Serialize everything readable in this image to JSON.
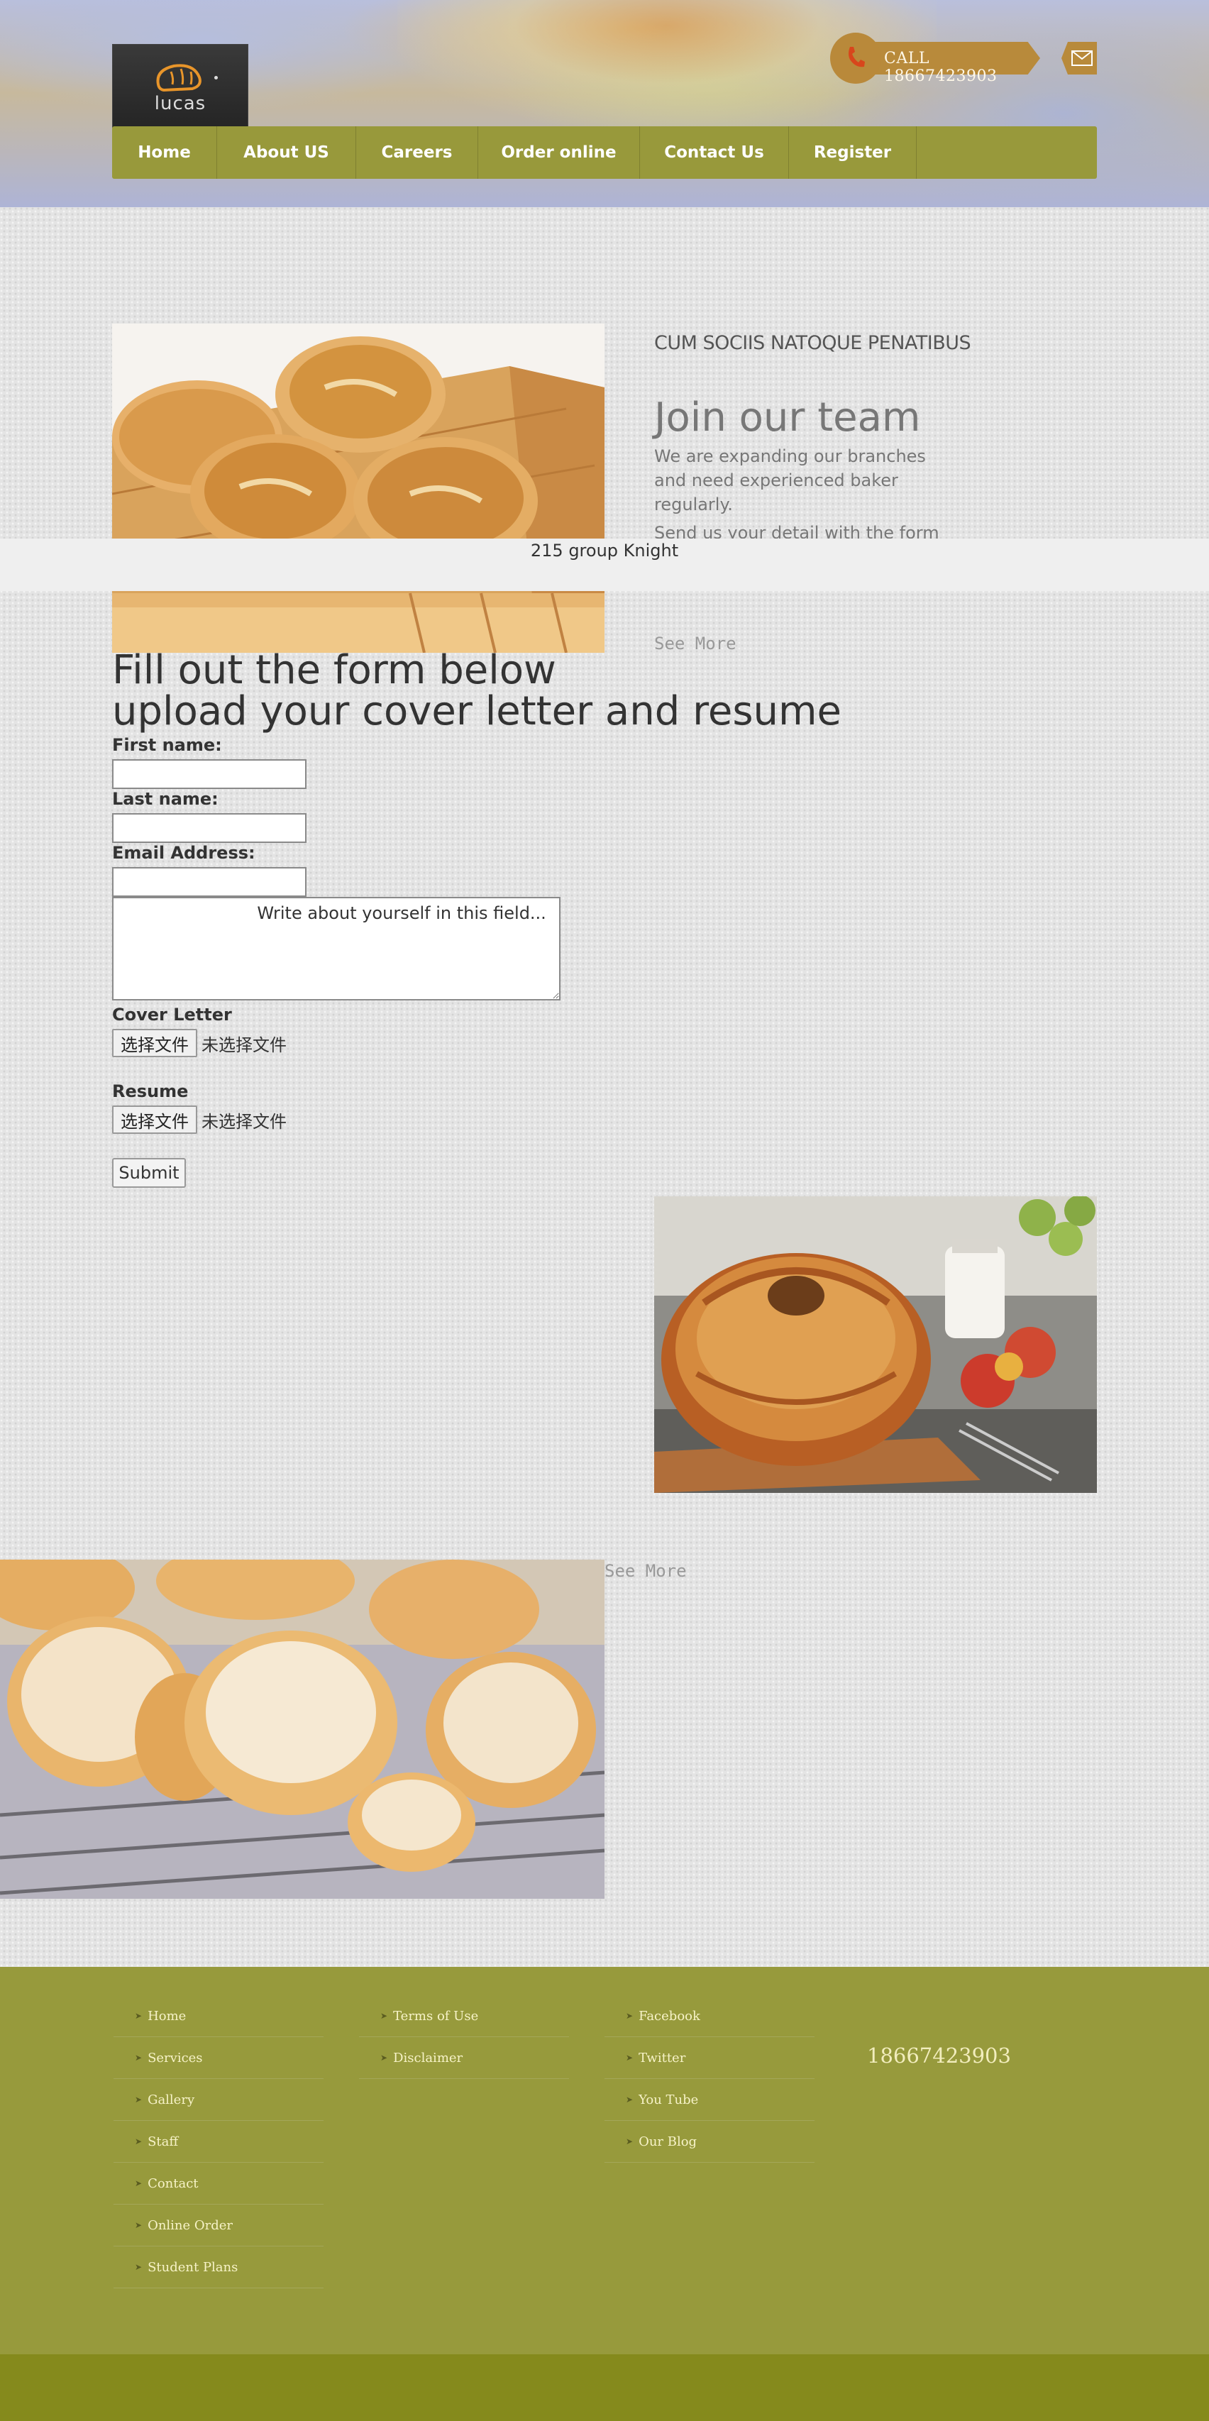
{
  "header": {
    "logo_text": "lucas",
    "call_text": "CALL  18667423903",
    "nav": [
      "Home",
      "About US",
      "Careers",
      "Order online",
      "Contact Us",
      "Register"
    ]
  },
  "join": {
    "subtitle": "CUM SOCIIS NATOQUE PENATIBUS",
    "title": "Join our team",
    "body1": "We are expanding our branches and need experienced baker regularly.",
    "body2": "Send us your detail with the form and we will be in contact shortly",
    "strip_text": "215 group Knight",
    "see_more": "See More"
  },
  "form": {
    "title_line1": "Fill out the form below",
    "title_line2": "upload your cover letter and resume",
    "first_name_label": "First name:",
    "last_name_label": "Last name:",
    "email_label": "Email Address:",
    "textarea_text": "                          Write about yourself in this field...",
    "cover_letter_label": "Cover Letter",
    "resume_label": "Resume",
    "choose_file": "选择文件",
    "no_file": "未选择文件",
    "submit": "Submit"
  },
  "gallery": {
    "see_more": "See More"
  },
  "footer": {
    "col1": [
      "Home",
      "Services",
      "Gallery",
      "Staff",
      "Contact",
      "Online Order",
      "Student Plans"
    ],
    "col2": [
      "Terms of Use",
      "Disclaimer"
    ],
    "col3": [
      "Facebook",
      "Twitter",
      "You Tube",
      "Our Blog"
    ],
    "phone": "18667423903"
  },
  "colors": {
    "nav": "#98993b",
    "footer": "#979a3c",
    "footer_bottom": "#858a1c",
    "call_badge": "#b88a3b"
  }
}
